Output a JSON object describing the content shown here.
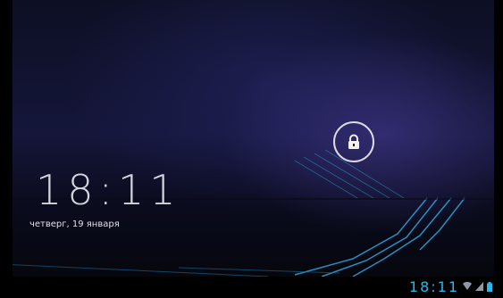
{
  "lockscreen": {
    "time": "18:11",
    "date": "четверг, 19 января",
    "unlock_icon": "lock-icon"
  },
  "statusbar": {
    "time": "18:11",
    "icons": [
      "wifi-icon",
      "signal-icon",
      "battery-icon"
    ],
    "accent": "#2fb6e4"
  }
}
